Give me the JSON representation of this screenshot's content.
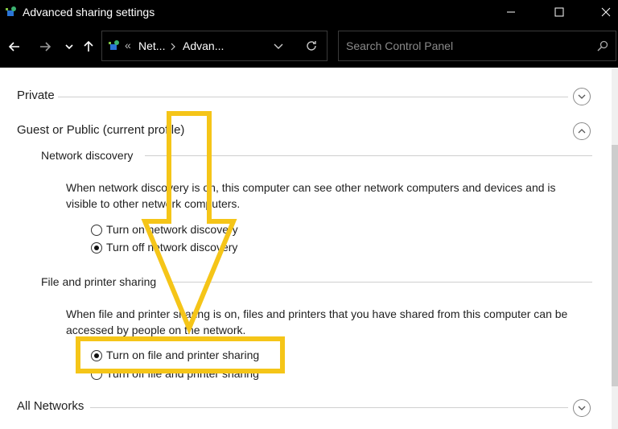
{
  "window": {
    "title": "Advanced sharing settings"
  },
  "nav": {
    "path": [
      "Net...",
      "Advan..."
    ],
    "overflow": "«",
    "search_placeholder": "Search Control Panel"
  },
  "sections": {
    "private": {
      "label": "Private"
    },
    "guest": {
      "label": "Guest or Public (current profile)",
      "network_discovery": {
        "heading": "Network discovery",
        "desc": "When network discovery is on, this computer can see other network computers and devices and is visible to other network computers.",
        "options": [
          {
            "label": "Turn on network discovery",
            "selected": false
          },
          {
            "label": "Turn off network discovery",
            "selected": true
          }
        ]
      },
      "file_sharing": {
        "heading": "File and printer sharing",
        "desc": "When file and printer sharing is on, files and printers that you have shared from this computer can be accessed by people on the network.",
        "options": [
          {
            "label": "Turn on file and printer sharing",
            "selected": true
          },
          {
            "label": "Turn off file and printer sharing",
            "selected": false
          }
        ]
      }
    },
    "all": {
      "label": "All Networks"
    }
  },
  "annotation_color": "#f5c518"
}
